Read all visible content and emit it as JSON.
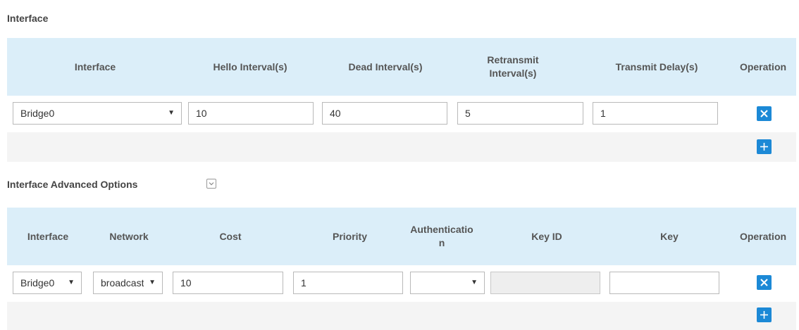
{
  "interface_section": {
    "title": "Interface",
    "headers": {
      "interface": "Interface",
      "hello": "Hello Interval(s)",
      "dead": "Dead Interval(s)",
      "retransmit": "Retransmit Interval(s)",
      "transmit": "Transmit Delay(s)",
      "operation": "Operation"
    },
    "row": {
      "interface": "Bridge0",
      "hello": "10",
      "dead": "40",
      "retransmit": "5",
      "transmit": "1"
    }
  },
  "advanced_section": {
    "title": "Interface Advanced Options",
    "headers": {
      "interface": "Interface",
      "network": "Network",
      "cost": "Cost",
      "priority": "Priority",
      "authentication": "Authentication",
      "key_id": "Key ID",
      "key": "Key",
      "operation": "Operation"
    },
    "row": {
      "interface": "Bridge0",
      "network": "broadcast",
      "cost": "10",
      "priority": "1",
      "authentication": "",
      "key_id": "",
      "key": ""
    }
  },
  "icons": {
    "delete": "close-icon",
    "add": "plus-icon",
    "toggle": "chevron-down-icon",
    "dropdown": "dropdown-arrow-icon"
  },
  "colors": {
    "header_bg": "#dbeef9",
    "row_bg": "#f4f4f4",
    "button_blue": "#1c89d6"
  }
}
